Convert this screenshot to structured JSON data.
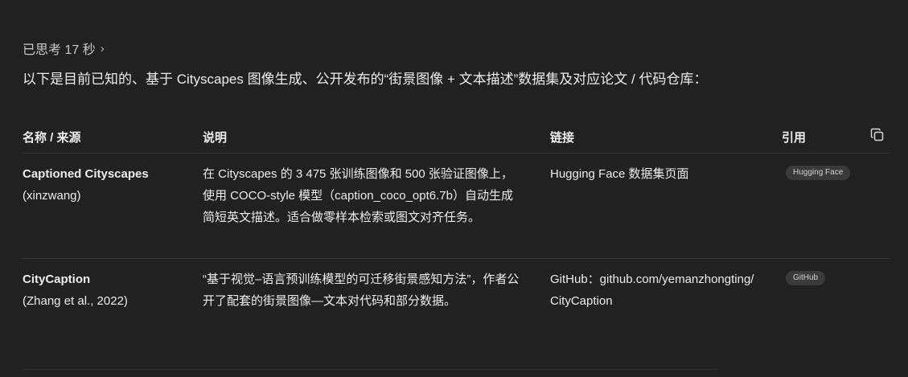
{
  "thought": {
    "label": "已思考 17 秒",
    "chevron": "›"
  },
  "intro": "以下是目前已知的、基于 Cityscapes 图像生成、公开发布的“街景图像 + 文本描述”数据集及对应论文 / 代码仓库：",
  "table": {
    "headers": {
      "name": "名称 / 来源",
      "desc": "说明",
      "link": "链接",
      "cite": "引用"
    },
    "rows": [
      {
        "name": "Captioned Cityscapes",
        "source": "(xinzwang)",
        "desc": "在 Cityscapes 的 3 475 张训练图像和 500 张验证图像上，使用 COCO-style 模型（caption_coco_opt6.7b）自动生成简短英文描述。适合做零样本检索或图文对齐任务。",
        "link": "Hugging Face 数据集页面",
        "badge": "Hugging Face"
      },
      {
        "name": "CityCaption",
        "source": "(Zhang et al., 2022)",
        "desc": "“基于视觉–语言预训练模型的可迁移街景感知方法”，作者公开了配套的街景图像—文本对代码和部分数据。",
        "link": "GitHub：github.com/yemanzhongting/CityCaption",
        "badge": "GitHub"
      }
    ]
  },
  "icons": {
    "copy": "copy-icon"
  }
}
